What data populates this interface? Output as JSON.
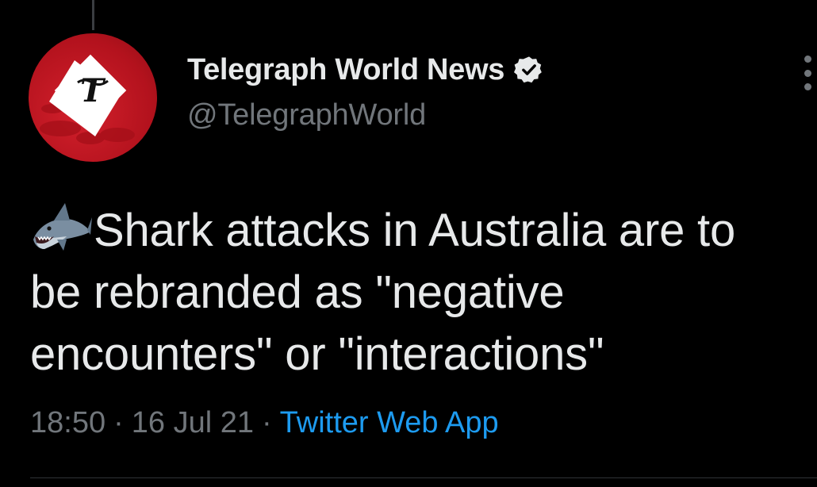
{
  "tweet": {
    "author": {
      "display_name": "Telegraph World News",
      "handle": "@TelegraphWorld",
      "verified": true,
      "avatar_icon": "telegraph-logo-icon"
    },
    "text_emoji": "shark-emoji-icon",
    "text": "Shark attacks in Australia are to be rebranded as \"negative encounters\" or \"interactions\"",
    "time": "18:50",
    "separator": "·",
    "date": "16 Jul 21",
    "source": "Twitter Web App"
  },
  "colors": {
    "background": "#000000",
    "text_primary": "#e7e9ea",
    "text_secondary": "#71767b",
    "link": "#1d9bf0",
    "avatar_red": "#c8161f"
  }
}
